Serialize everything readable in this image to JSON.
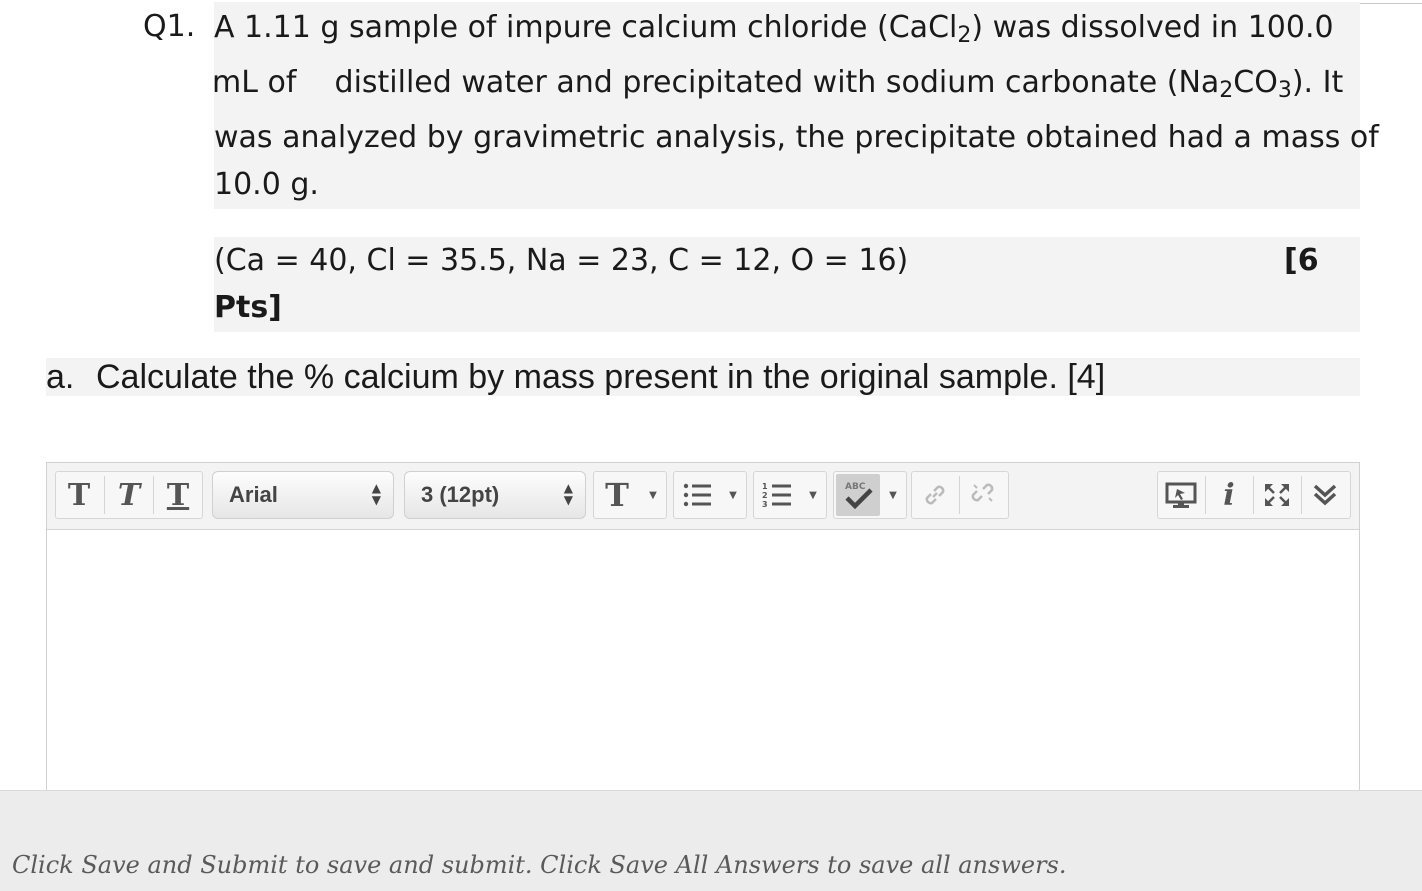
{
  "question": {
    "number": "Q1.",
    "line1_a": "A 1.11 g sample of impure calcium chloride (CaCl",
    "line1_sub": "2",
    "line1_b": ") was dissolved in 100.0",
    "line2_a": "mL of    distilled water and precipitated with sodium carbonate (Na",
    "line2_sub1": "2",
    "line2_b": "CO",
    "line2_sub2": "3",
    "line2_c": "). It",
    "line3": "was analyzed by gravimetric analysis, the precipitate obtained had a mass of",
    "line4": "10.0 g."
  },
  "constants": {
    "formula": "(Ca = 40, Cl = 35.5, Na = 23, C = 12, O = 16)",
    "points_line1": "[6",
    "points_line2": "Pts]"
  },
  "part_a": {
    "label": "a.",
    "text": "Calculate the % calcium by mass present in the original sample. [4]"
  },
  "editor": {
    "font_select": "Arial",
    "size_select": "3 (12pt)",
    "body_text": ""
  },
  "footer": {
    "note": "Click Save and Submit to save and submit. Click Save All Answers to save all answers."
  }
}
